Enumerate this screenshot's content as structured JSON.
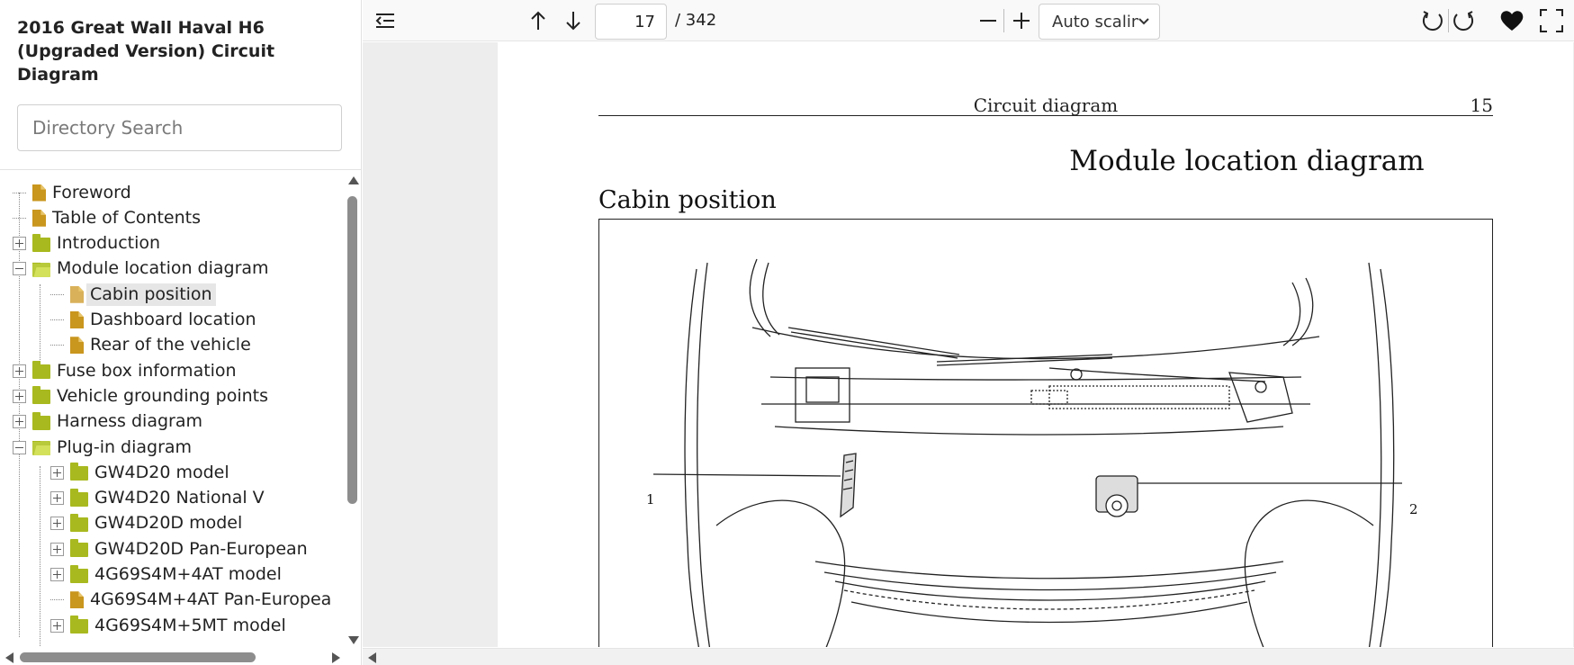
{
  "sidebar": {
    "title": "2016 Great Wall Haval H6 (Upgraded Version) Circuit Diagram",
    "search_placeholder": "Directory Search",
    "tree": [
      {
        "label": "Foreword",
        "icon": "file-icon",
        "level": 0,
        "toggle": "none"
      },
      {
        "label": "Table of Contents",
        "icon": "file-icon",
        "level": 0,
        "toggle": "none"
      },
      {
        "label": "Introduction",
        "icon": "folder-icon",
        "level": 0,
        "toggle": "plus"
      },
      {
        "label": "Module location diagram",
        "icon": "folder-open-icon",
        "level": 0,
        "toggle": "minus"
      },
      {
        "label": "Cabin position",
        "icon": "file-icon",
        "level": 1,
        "toggle": "none",
        "selected": true
      },
      {
        "label": "Dashboard location",
        "icon": "file-icon",
        "level": 1,
        "toggle": "none"
      },
      {
        "label": "Rear of the vehicle",
        "icon": "file-icon",
        "level": 1,
        "toggle": "none"
      },
      {
        "label": "Fuse box information",
        "icon": "folder-icon",
        "level": 0,
        "toggle": "plus"
      },
      {
        "label": "Vehicle grounding points",
        "icon": "folder-icon",
        "level": 0,
        "toggle": "plus"
      },
      {
        "label": "Harness diagram",
        "icon": "folder-icon",
        "level": 0,
        "toggle": "plus"
      },
      {
        "label": "Plug-in diagram",
        "icon": "folder-open-icon",
        "level": 0,
        "toggle": "minus"
      },
      {
        "label": "GW4D20 model",
        "icon": "folder-icon",
        "level": 1,
        "toggle": "plus"
      },
      {
        "label": "GW4D20 National V",
        "icon": "folder-icon",
        "level": 1,
        "toggle": "plus"
      },
      {
        "label": "GW4D20D model",
        "icon": "folder-icon",
        "level": 1,
        "toggle": "plus"
      },
      {
        "label": "GW4D20D Pan-European",
        "icon": "folder-icon",
        "level": 1,
        "toggle": "plus"
      },
      {
        "label": "4G69S4M+4AT model",
        "icon": "folder-icon",
        "level": 1,
        "toggle": "plus"
      },
      {
        "label": "4G69S4M+4AT Pan-Europea",
        "icon": "file-icon",
        "level": 1,
        "toggle": "none"
      },
      {
        "label": "4G69S4M+5MT model",
        "icon": "folder-icon",
        "level": 1,
        "toggle": "plus"
      }
    ]
  },
  "toolbar": {
    "current_page": "17",
    "page_total": "/ 342",
    "scale_label": "Auto scaling",
    "icons": [
      "sidebar-toggle-icon",
      "arrow-up-icon",
      "arrow-down-icon",
      "zoom-out-icon",
      "zoom-in-icon",
      "rotate-ccw-icon",
      "rotate-cw-icon",
      "heart-icon",
      "fullscreen-icon"
    ]
  },
  "document": {
    "header_text": "Circuit diagram",
    "page_number": "15",
    "title": "Module location diagram",
    "section": "Cabin position",
    "callouts": [
      "1",
      "2"
    ]
  },
  "colors": {
    "file_icon": "#c9961e",
    "folder_icon": "#a8b91f",
    "selected_bg": "#e6e6e6",
    "toolbar_bg": "#f9f9fa",
    "viewer_bg": "#ededed"
  }
}
